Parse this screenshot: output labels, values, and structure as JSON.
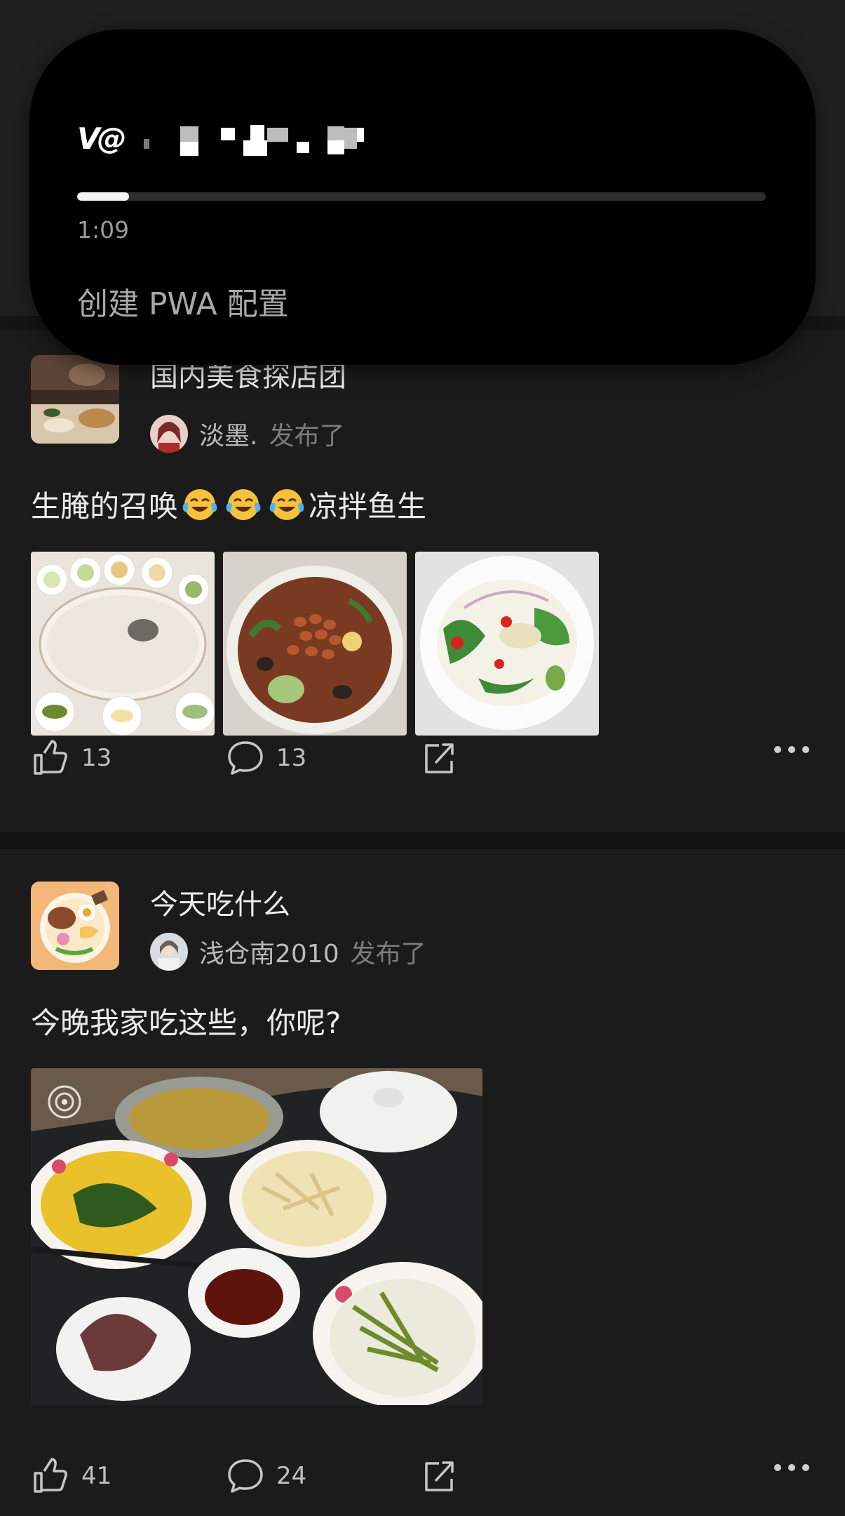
{
  "island": {
    "app_mark": "V@",
    "progress_fraction": 0.075,
    "elapsed": "1:09",
    "action_label": "创建 PWA 配置"
  },
  "posts": [
    {
      "group_name": "国内美食探店团",
      "user_name": "淡墨.",
      "posted_label": "发布了",
      "text_before": "生腌的召唤",
      "emoji_count": 3,
      "emoji_name": "tears-of-joy",
      "text_after": "凉拌鱼生",
      "images": [
        "raw-fish-platter-photo",
        "snail-peanut-salad-photo",
        "fish-skin-salad-photo"
      ],
      "likes": "13",
      "comments": "13"
    },
    {
      "group_name": "今天吃什么",
      "user_name": "浅仓南2010",
      "posted_label": "发布了",
      "text": "今晚我家吃这些，你呢?",
      "images": [
        "family-dinner-table-photo"
      ],
      "likes": "41",
      "comments": "24"
    }
  ],
  "colors": {
    "background": "#1b1b1b",
    "island": "#000000",
    "text_primary": "#ececec",
    "text_secondary": "#7c7c7c"
  }
}
